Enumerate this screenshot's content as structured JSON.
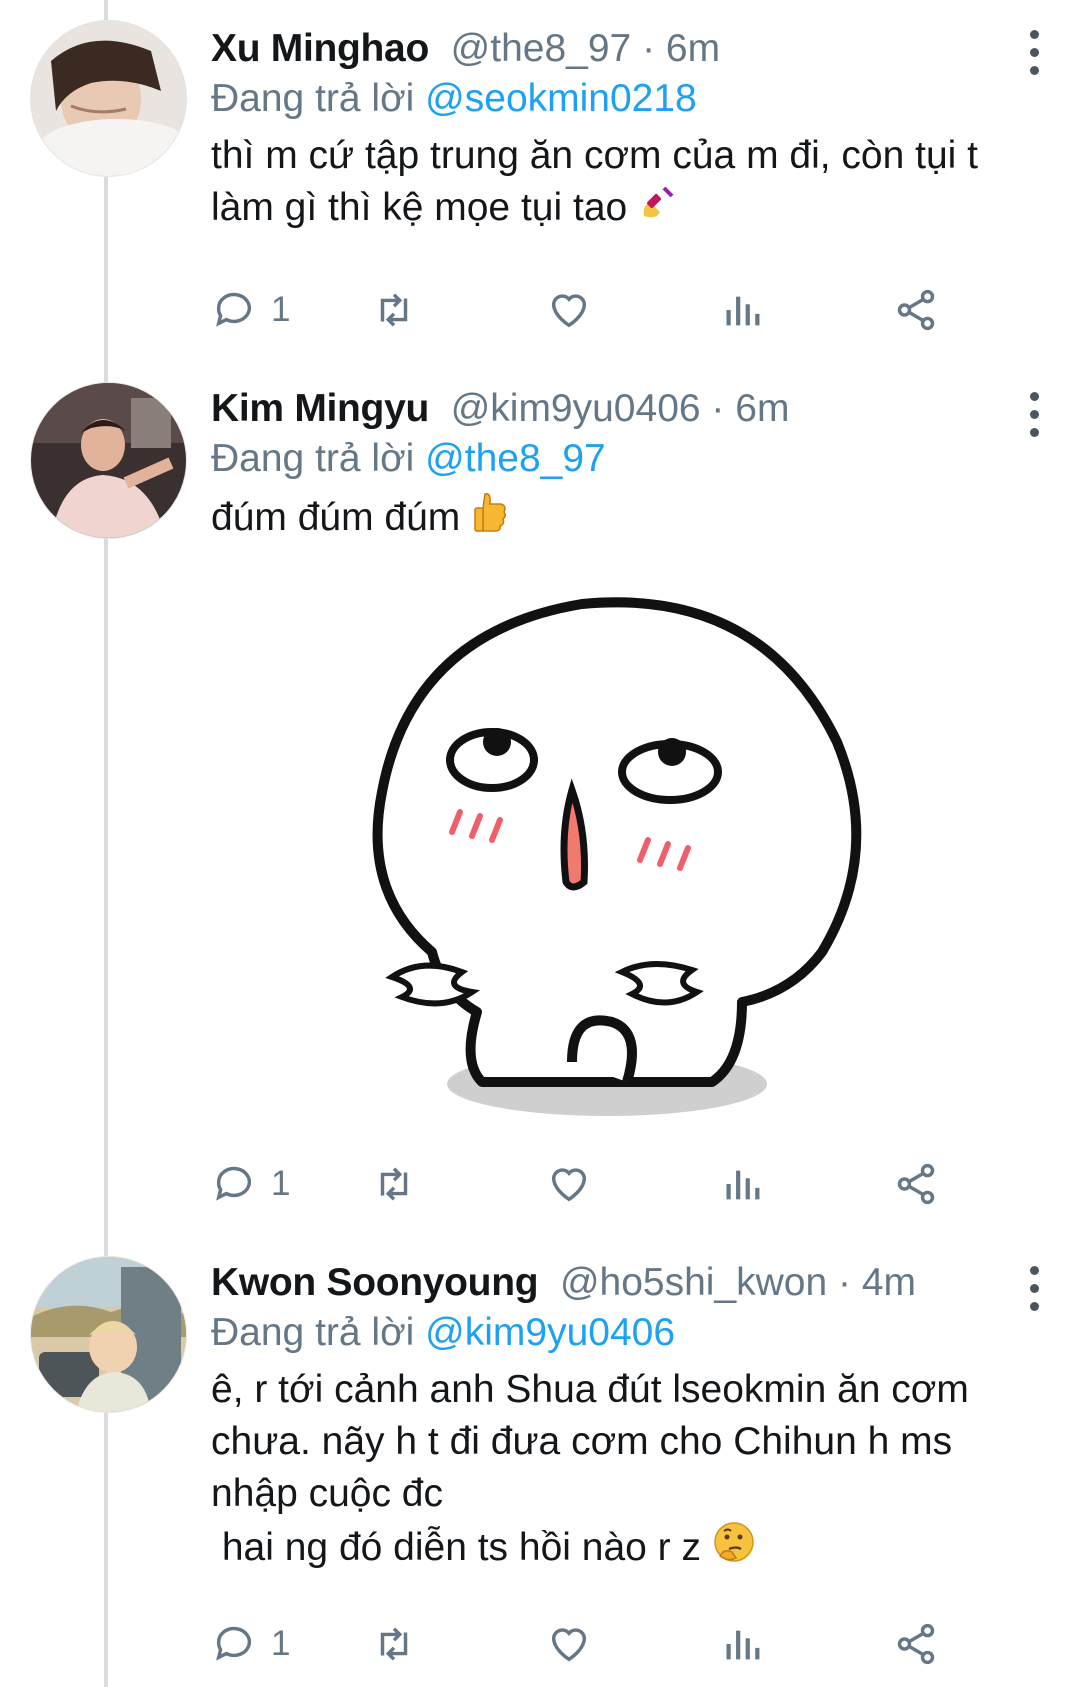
{
  "tweets": [
    {
      "name": "Xu Minghao",
      "handle": "@the8_97",
      "sep": " · ",
      "time": "6m",
      "reply_prefix": "Đang trả lời ",
      "reply_to": "@seokmin0218",
      "text": "thì m cứ tập trung ăn cơm của m đi, còn tụi t làm gì thì kệ mọe tụi tao",
      "emoji": "nail-polish",
      "replies": "1"
    },
    {
      "name": "Kim Mingyu",
      "handle": "@kim9yu0406",
      "sep": " · ",
      "time": "6m",
      "reply_prefix": "Đang trả lời ",
      "reply_to": "@the8_97",
      "text": "đúm đúm đúm",
      "emoji": "thumbs-up",
      "replies": "1"
    },
    {
      "name": "Kwon Soonyoung",
      "handle": "@ho5shi_kwon",
      "sep": " · ",
      "time": "4m",
      "reply_prefix": "Đang trả lời ",
      "reply_to": "@kim9yu0406",
      "text": "ê, r tới cảnh anh Shua đút lseokmin ăn cơm chưa. nãy h t đi đưa cơm cho Chihun h ms nhập cuộc đc\n hai ng đó diễn ts hồi nào r z",
      "emoji": "thinking-face",
      "replies": "1"
    }
  ]
}
